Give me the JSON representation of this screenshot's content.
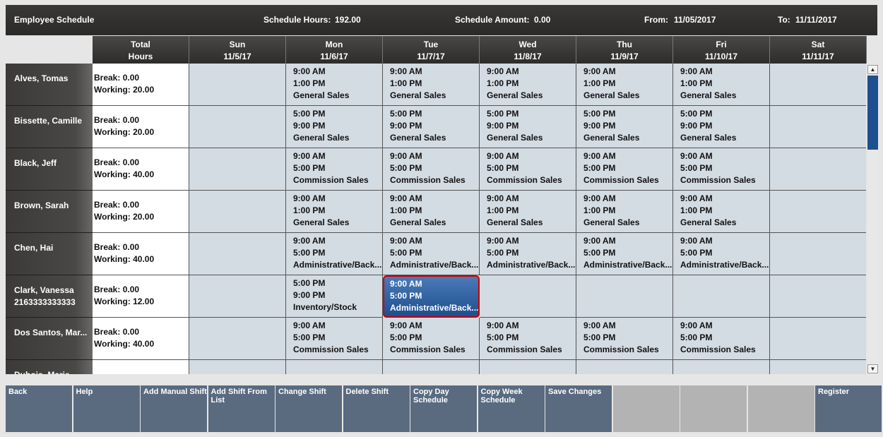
{
  "header": {
    "title": "Employee Schedule",
    "schedule_hours_label": "Schedule Hours:",
    "schedule_hours": "192.00",
    "schedule_amount_label": "Schedule Amount:",
    "schedule_amount": "0.00",
    "from_label": "From:",
    "from_date": "11/05/2017",
    "to_label": "To:",
    "to_date": "11/11/2017"
  },
  "columns": {
    "total": {
      "line1": "Total",
      "line2": "Hours"
    },
    "days": [
      {
        "name": "Sun",
        "date": "11/5/17"
      },
      {
        "name": "Mon",
        "date": "11/6/17"
      },
      {
        "name": "Tue",
        "date": "11/7/17"
      },
      {
        "name": "Wed",
        "date": "11/8/17"
      },
      {
        "name": "Thu",
        "date": "11/9/17"
      },
      {
        "name": "Fri",
        "date": "11/10/17"
      },
      {
        "name": "Sat",
        "date": "11/11/17"
      }
    ]
  },
  "employees": [
    {
      "name": "Alves, Tomas",
      "phone": "",
      "break": "Break:  0.00",
      "working": "Working:  20.00",
      "shifts": [
        null,
        [
          "9:00 AM",
          "1:00 PM",
          "General Sales"
        ],
        [
          "9:00 AM",
          "1:00 PM",
          "General Sales"
        ],
        [
          "9:00 AM",
          "1:00 PM",
          "General Sales"
        ],
        [
          "9:00 AM",
          "1:00 PM",
          "General Sales"
        ],
        [
          "9:00 AM",
          "1:00 PM",
          "General Sales"
        ],
        null
      ]
    },
    {
      "name": "Bissette, Camille",
      "phone": "",
      "break": "Break:  0.00",
      "working": "Working:  20.00",
      "shifts": [
        null,
        [
          "5:00 PM",
          "9:00 PM",
          "General Sales"
        ],
        [
          "5:00 PM",
          "9:00 PM",
          "General Sales"
        ],
        [
          "5:00 PM",
          "9:00 PM",
          "General Sales"
        ],
        [
          "5:00 PM",
          "9:00 PM",
          "General Sales"
        ],
        [
          "5:00 PM",
          "9:00 PM",
          "General Sales"
        ],
        null
      ]
    },
    {
      "name": "Black, Jeff",
      "phone": "",
      "break": "Break:  0.00",
      "working": "Working:  40.00",
      "shifts": [
        null,
        [
          "9:00 AM",
          "5:00 PM",
          "Commission Sales"
        ],
        [
          "9:00 AM",
          "5:00 PM",
          "Commission Sales"
        ],
        [
          "9:00 AM",
          "5:00 PM",
          "Commission Sales"
        ],
        [
          "9:00 AM",
          "5:00 PM",
          "Commission Sales"
        ],
        [
          "9:00 AM",
          "5:00 PM",
          "Commission Sales"
        ],
        null
      ]
    },
    {
      "name": "Brown, Sarah",
      "phone": "",
      "break": "Break:  0.00",
      "working": "Working:  20.00",
      "shifts": [
        null,
        [
          "9:00 AM",
          "1:00 PM",
          "General Sales"
        ],
        [
          "9:00 AM",
          "1:00 PM",
          "General Sales"
        ],
        [
          "9:00 AM",
          "1:00 PM",
          "General Sales"
        ],
        [
          "9:00 AM",
          "1:00 PM",
          "General Sales"
        ],
        [
          "9:00 AM",
          "1:00 PM",
          "General Sales"
        ],
        null
      ]
    },
    {
      "name": "Chen, Hai",
      "phone": "",
      "break": "Break:  0.00",
      "working": "Working:  40.00",
      "shifts": [
        null,
        [
          "9:00 AM",
          "5:00 PM",
          "Administrative/Back..."
        ],
        [
          "9:00 AM",
          "5:00 PM",
          "Administrative/Back..."
        ],
        [
          "9:00 AM",
          "5:00 PM",
          "Administrative/Back..."
        ],
        [
          "9:00 AM",
          "5:00 PM",
          "Administrative/Back..."
        ],
        [
          "9:00 AM",
          "5:00 PM",
          "Administrative/Back..."
        ],
        null
      ]
    },
    {
      "name": "Clark, Vanessa",
      "phone": "2163333333333",
      "break": "Break:  0.00",
      "working": "Working:  12.00",
      "shifts": [
        null,
        [
          "5:00 PM",
          "9:00 PM",
          "Inventory/Stock"
        ],
        [
          "9:00 AM",
          "5:00 PM",
          "Administrative/Back..."
        ],
        null,
        null,
        null,
        null
      ]
    },
    {
      "name": "Dos Santos, Mar...",
      "phone": "",
      "break": "Break:  0.00",
      "working": "Working:  40.00",
      "shifts": [
        null,
        [
          "9:00 AM",
          "5:00 PM",
          "Commission Sales"
        ],
        [
          "9:00 AM",
          "5:00 PM",
          "Commission Sales"
        ],
        [
          "9:00 AM",
          "5:00 PM",
          "Commission Sales"
        ],
        [
          "9:00 AM",
          "5:00 PM",
          "Commission Sales"
        ],
        [
          "9:00 AM",
          "5:00 PM",
          "Commission Sales"
        ],
        null
      ]
    },
    {
      "name": "Dubois, Marie",
      "phone": "",
      "break": "",
      "working": "",
      "shifts": [
        null,
        null,
        null,
        null,
        null,
        null,
        null
      ]
    }
  ],
  "selected": {
    "row": 5,
    "day": 2
  },
  "buttons": [
    {
      "label": "Back"
    },
    {
      "label": "Help"
    },
    {
      "label": "Add Manual Shift"
    },
    {
      "label": "Add Shift From List"
    },
    {
      "label": "Change Shift"
    },
    {
      "label": "Delete Shift"
    },
    {
      "label": "Copy Day Schedule"
    },
    {
      "label": "Copy Week Schedule"
    },
    {
      "label": "Save Changes"
    },
    {
      "label": ""
    },
    {
      "label": ""
    },
    {
      "label": ""
    },
    {
      "label": "Register"
    }
  ],
  "scrollbar": {
    "up_icon": "triangle-up-icon",
    "down_icon": "triangle-down-icon"
  }
}
